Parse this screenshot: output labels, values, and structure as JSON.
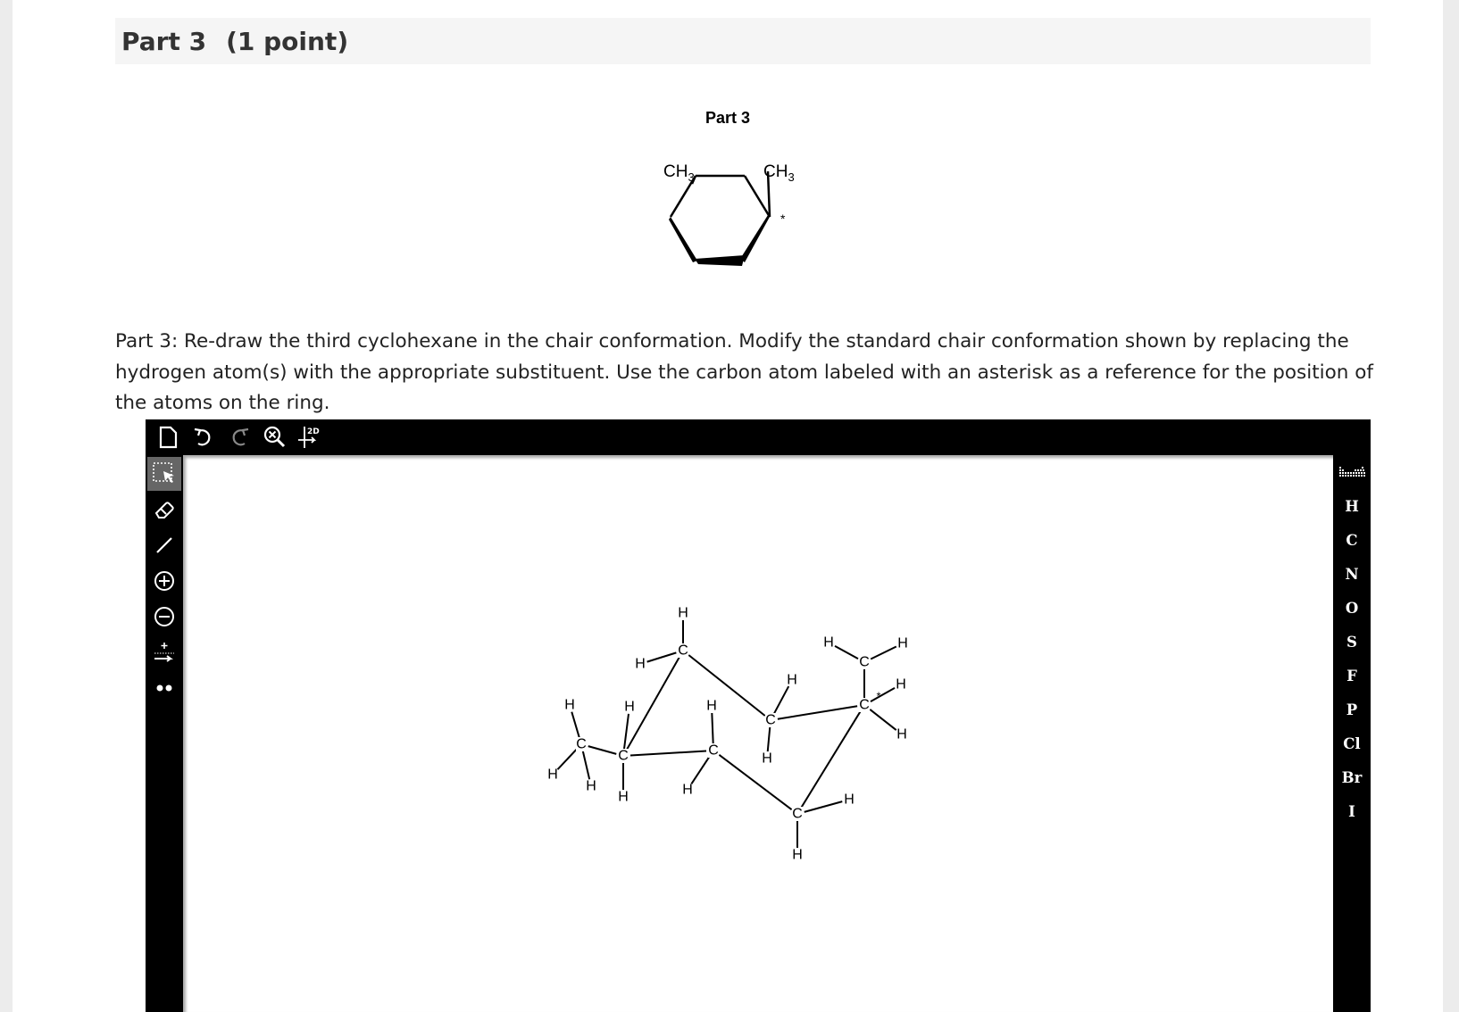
{
  "header": {
    "part": "Part 3",
    "points": "(1 point)"
  },
  "structure": {
    "title": "Part 3",
    "left_substituent": "CH3",
    "right_substituent": "CH3",
    "reference_mark": "*"
  },
  "instructions": "Part 3: Re-draw the third cyclohexane in the chair conformation. Modify the standard chair conformation shown by replacing the hydrogen atom(s) with the appropriate substituent. Use the carbon atom labeled with an asterisk as a reference for the position of the atoms on the ring.",
  "editor": {
    "top_tools": [
      "new-document-icon",
      "undo-icon",
      "redo-icon",
      "zoom-clear-icon",
      "clean-2d-icon"
    ],
    "clean_label": "2D",
    "left_tools": [
      "select-icon",
      "eraser-icon",
      "bond-icon",
      "positive-charge-icon",
      "negative-charge-icon",
      "arrow-icon",
      "lone-pair-icon"
    ],
    "elements": [
      "H",
      "C",
      "N",
      "O",
      "S",
      "F",
      "P",
      "Cl",
      "Br",
      "I"
    ],
    "atom_labels": {
      "carbon": "C",
      "hydrogen": "H",
      "reference_mark": "*"
    },
    "colors": {
      "toolbar": "#000000",
      "canvas": "#ffffff",
      "active_tool": "#666666"
    }
  }
}
